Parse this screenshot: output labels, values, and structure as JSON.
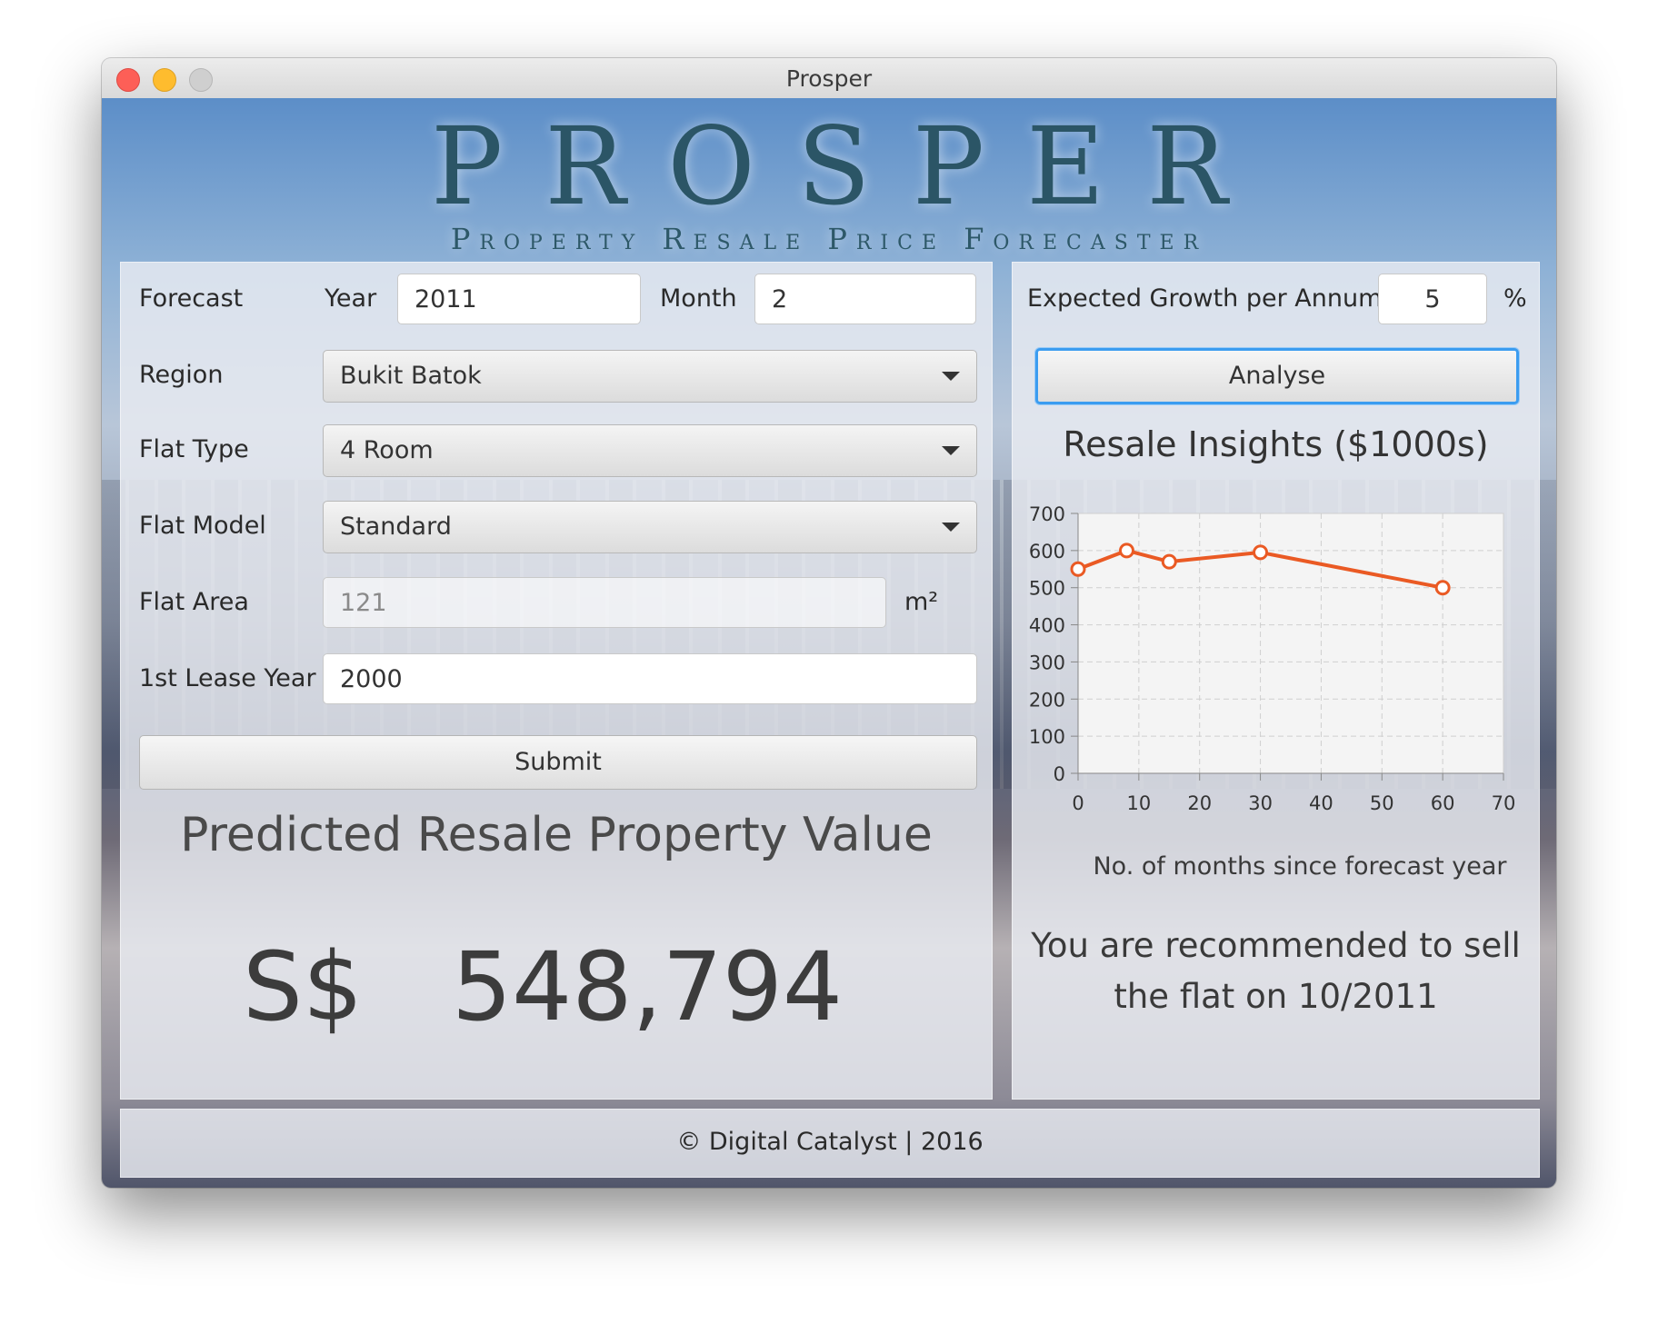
{
  "window": {
    "title": "Prosper"
  },
  "brand": {
    "title": "PROSPER",
    "subtitle": "Property Resale Price Forecaster"
  },
  "form": {
    "forecast_label": "Forecast",
    "year_label": "Year",
    "year_value": "2011",
    "month_label": "Month",
    "month_value": "2",
    "region_label": "Region",
    "region_value": "Bukit Batok",
    "flat_type_label": "Flat Type",
    "flat_type_value": "4 Room",
    "flat_model_label": "Flat Model",
    "flat_model_value": "Standard",
    "flat_area_label": "Flat Area",
    "flat_area_value": "121",
    "flat_area_unit": "m²",
    "lease_year_label": "1st Lease Year",
    "lease_year_value": "2000",
    "submit_label": "Submit"
  },
  "prediction": {
    "title": "Predicted Resale Property Value",
    "currency": "S$",
    "value": "548,794"
  },
  "analysis": {
    "growth_label": "Expected Growth per Annum",
    "growth_value": "5",
    "growth_unit": "%",
    "analyse_label": "Analyse",
    "recommendation_line1": "You are recommended to sell",
    "recommendation_line2": "the flat on 10/2011"
  },
  "chart_data": {
    "type": "line",
    "title": "Resale Insights ($1000s)",
    "xlabel": "No. of months since forecast year",
    "ylabel": "",
    "x": [
      0,
      8,
      15,
      30,
      60
    ],
    "values": [
      550,
      600,
      570,
      595,
      500
    ],
    "xlim": [
      0,
      70
    ],
    "ylim": [
      0,
      700
    ],
    "xticks": [
      0,
      10,
      20,
      30,
      40,
      50,
      60,
      70
    ],
    "yticks": [
      0,
      100,
      200,
      300,
      400,
      500,
      600,
      700
    ],
    "grid": true,
    "color": "#ea5a24"
  },
  "footer": {
    "text": "© Digital Catalyst | 2016"
  }
}
